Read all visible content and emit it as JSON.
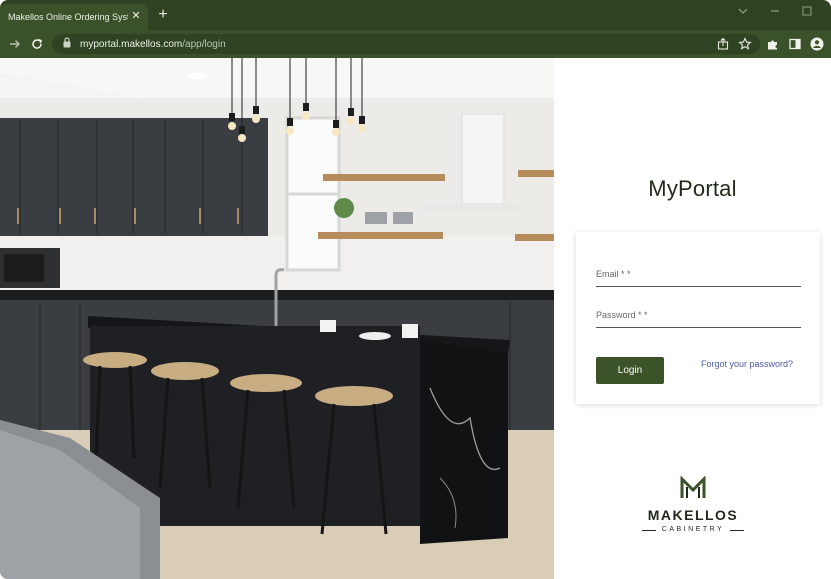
{
  "browser": {
    "tab_title": "Makellos Online Ordering System",
    "url_host": "myportal.makellos.com",
    "url_path": "/app/login"
  },
  "icons": {
    "close": "close-icon",
    "new_tab": "plus-icon",
    "forward": "arrow-right-icon",
    "reload": "reload-icon",
    "lock": "lock-icon",
    "share": "share-icon",
    "star": "star-icon",
    "extensions": "puzzle-icon",
    "sidepanel": "sidepanel-icon",
    "profile": "profile-icon"
  },
  "colors": {
    "chrome_dark": "#2f4221",
    "chrome_tab": "#3b5129",
    "brand_green": "#3c5228",
    "link_blue": "#4e5da8"
  },
  "portal": {
    "title": "MyPortal",
    "email_label": "Email * *",
    "password_label": "Password * *",
    "login_label": "Login",
    "forgot_label": "Forgot your password?"
  },
  "logo": {
    "name": "MAKELLOS",
    "sub": "CABINETRY"
  }
}
